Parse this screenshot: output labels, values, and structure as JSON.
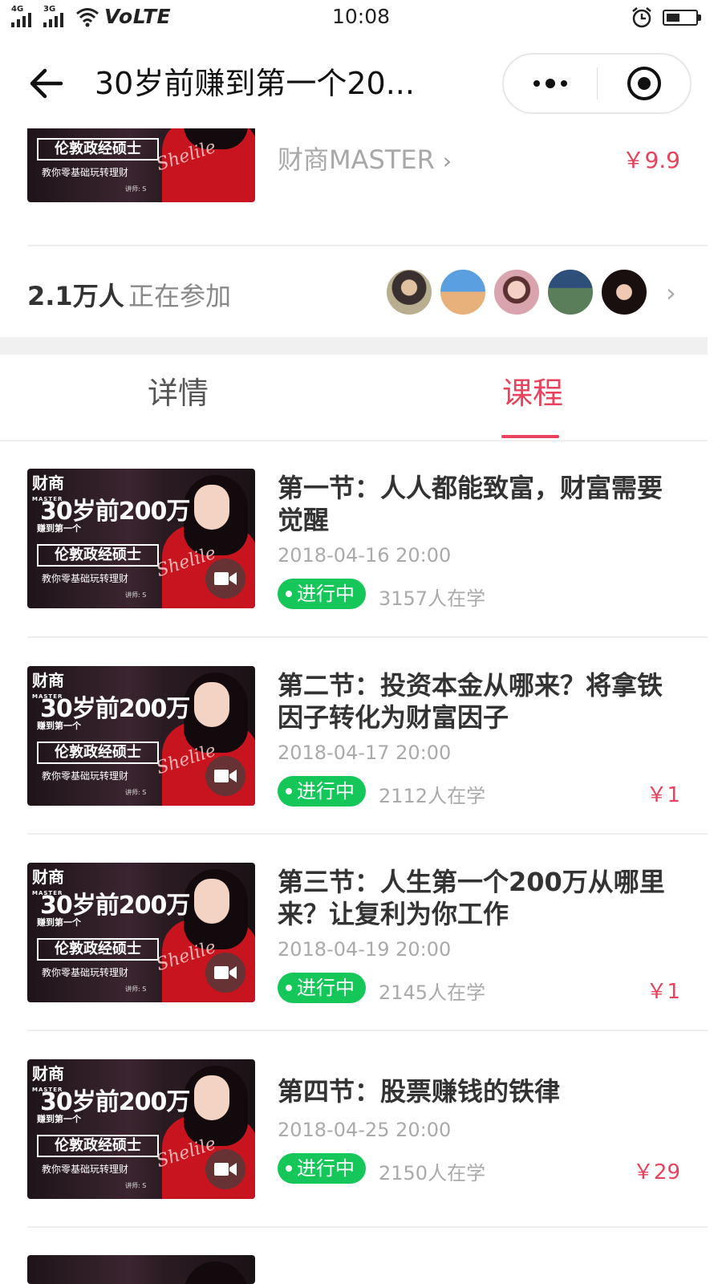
{
  "status_bar": {
    "network1": "4G",
    "network2": "3G",
    "volte": "VoLTE",
    "time": "10:08"
  },
  "nav": {
    "title": "30岁前赚到第一个20..."
  },
  "top_course": {
    "author": "财商MASTER",
    "price": "￥9.9"
  },
  "participants": {
    "count": "2.1万人",
    "label": "正在参加"
  },
  "tabs": [
    {
      "label": "详情"
    },
    {
      "label": "课程"
    }
  ],
  "thumbnail_text": {
    "brand": "财商",
    "brand_sub": "MASTER",
    "big": "30岁前200万",
    "line1": "赚到第一个",
    "band": "伦敦政经硕士",
    "line2": "教你零基础玩转理财",
    "signature": "Shelile",
    "lecturer": "讲师: S"
  },
  "courses": [
    {
      "title": "第一节：人人都能致富，财富需要觉醒",
      "date": "2018-04-16 20:00",
      "status": "进行中",
      "learners": "3157人在学",
      "price": ""
    },
    {
      "title": "第二节：投资本金从哪来？将拿铁因子转化为财富因子",
      "date": "2018-04-17 20:00",
      "status": "进行中",
      "learners": "2112人在学",
      "price": "￥1"
    },
    {
      "title": "第三节：人生第一个200万从哪里来？让复利为你工作",
      "date": "2018-04-19 20:00",
      "status": "进行中",
      "learners": "2145人在学",
      "price": "￥1"
    },
    {
      "title": "第四节：股票赚钱的铁律",
      "date": "2018-04-25 20:00",
      "status": "进行中",
      "learners": "2150人在学",
      "price": "￥29"
    }
  ],
  "colors": {
    "accent": "#e8425c",
    "status_green": "#15c659"
  }
}
